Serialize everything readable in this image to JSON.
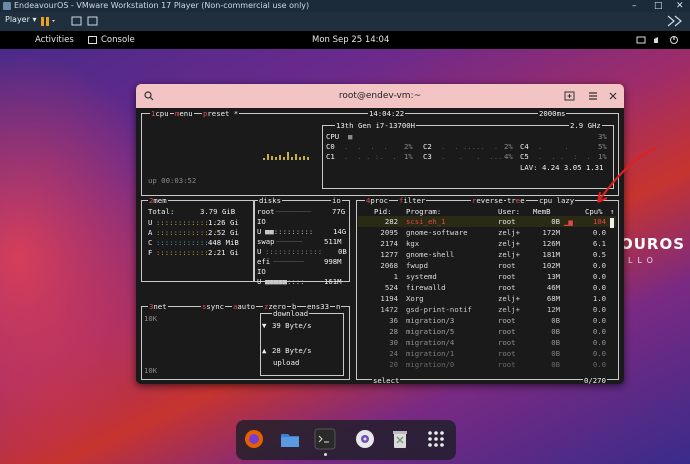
{
  "vm": {
    "title": "EndeavourOS - VMware Workstation 17 Player (Non-commercial use only)",
    "player_menu": "Player",
    "minimize": "–",
    "maximize": "□",
    "close": "✕"
  },
  "gnome": {
    "activities": "Activities",
    "console_app": "Console",
    "clock": "Mon Sep 25  14:04"
  },
  "desktop": {
    "brand": "OUROS",
    "brand_sub": "LLO"
  },
  "window": {
    "title": "root@endev-vm:~"
  },
  "btop": {
    "cpu_tab": {
      "num": "1",
      "label": "cpu"
    },
    "menu_tab": {
      "key": "m",
      "label": "enu"
    },
    "preset_tab": {
      "key": "p",
      "label": "reset *"
    },
    "time": "14:04:22",
    "interval": "2000ms",
    "cpu_model": "13th Gen i7-13700H",
    "freq": "2.9 GHz",
    "cpu_rows": [
      {
        "name": "CPU",
        "pct": "3%"
      },
      {
        "name": "C0",
        "pct": "2%"
      },
      {
        "name": "C1",
        "pct": "1%"
      }
    ],
    "cpu_rows2": [
      {
        "name": "C2",
        "pct": "2%"
      },
      {
        "name": "C3",
        "pct": "4%"
      },
      {
        "name": "C4",
        "pct": "5%"
      },
      {
        "name": "C5",
        "pct": "1%"
      }
    ],
    "lav": "LAV: 4.24 3.05 1.31",
    "uptime": "up 00:03:52",
    "mem": {
      "title": "mem",
      "total_label": "Total:",
      "total": "3.79 GiB",
      "rows": [
        {
          "k": "U",
          "v": "1.26 Gi"
        },
        {
          "k": "A",
          "v": "2.52 Gi"
        },
        {
          "k": "C",
          "v": "448 MiB"
        },
        {
          "k": "F",
          "v": "2.21 Gi"
        }
      ]
    },
    "disks": {
      "title": "disks",
      "io_tab": "io",
      "root_label": "root",
      "root_size": "77G",
      "io": "IO",
      "u_val": "14G",
      "swap_label": "swap",
      "swap_size": "511M",
      "swap_u": "0B",
      "efi_label": "efi",
      "efi_size": "998M",
      "efi_io": "IO",
      "efi_u": "161M"
    },
    "net": {
      "title": "net",
      "sync": "sync",
      "auto": "auto",
      "zero": "zero",
      "b": "b",
      "iface": "ens33",
      "n": "n",
      "scale_top": "10K",
      "scale_bot": "10K",
      "download_label": "download",
      "download": "39 Byte/s",
      "upload": "28 Byte/s",
      "upload_label": "upload"
    },
    "proc": {
      "num": "4",
      "title": "proc",
      "filter": "filter",
      "reverse": "reverse",
      "tree": "tree",
      "sort": "cpu lazy",
      "headers": [
        "Pid:",
        "Program:",
        "User:",
        "MemB",
        "Cpu%"
      ],
      "rows": [
        {
          "pid": "282",
          "prog": "scsi_eh_1",
          "user": "root",
          "mem": "0B",
          "cpu": "104"
        },
        {
          "pid": "2095",
          "prog": "gnome-software",
          "user": "zelj+",
          "mem": "172M",
          "cpu": "0.0"
        },
        {
          "pid": "2174",
          "prog": "kgx",
          "user": "zelj+",
          "mem": "126M",
          "cpu": "6.1"
        },
        {
          "pid": "1277",
          "prog": "gnome-shell",
          "user": "zelj+",
          "mem": "181M",
          "cpu": "0.5"
        },
        {
          "pid": "2068",
          "prog": "fwupd",
          "user": "root",
          "mem": "102M",
          "cpu": "0.0"
        },
        {
          "pid": "1",
          "prog": "systemd",
          "user": "root",
          "mem": "13M",
          "cpu": "0.0"
        },
        {
          "pid": "524",
          "prog": "firewalld",
          "user": "root",
          "mem": "46M",
          "cpu": "0.0"
        },
        {
          "pid": "1194",
          "prog": "Xorg",
          "user": "zelj+",
          "mem": "68M",
          "cpu": "1.0"
        },
        {
          "pid": "1472",
          "prog": "gsd-print-notif",
          "user": "zelj+",
          "mem": "12M",
          "cpu": "0.0"
        },
        {
          "pid": "36",
          "prog": "migration/3",
          "user": "root",
          "mem": "0B",
          "cpu": "0.0"
        },
        {
          "pid": "28",
          "prog": "migration/5",
          "user": "root",
          "mem": "0B",
          "cpu": "0.0"
        },
        {
          "pid": "30",
          "prog": "migration/4",
          "user": "root",
          "mem": "0B",
          "cpu": "0.0"
        },
        {
          "pid": "24",
          "prog": "migration/1",
          "user": "root",
          "mem": "0B",
          "cpu": "0.0"
        },
        {
          "pid": "20",
          "prog": "migration/0",
          "user": "root",
          "mem": "0B",
          "cpu": "0.0"
        }
      ],
      "select": "select",
      "count": "0/270"
    }
  }
}
